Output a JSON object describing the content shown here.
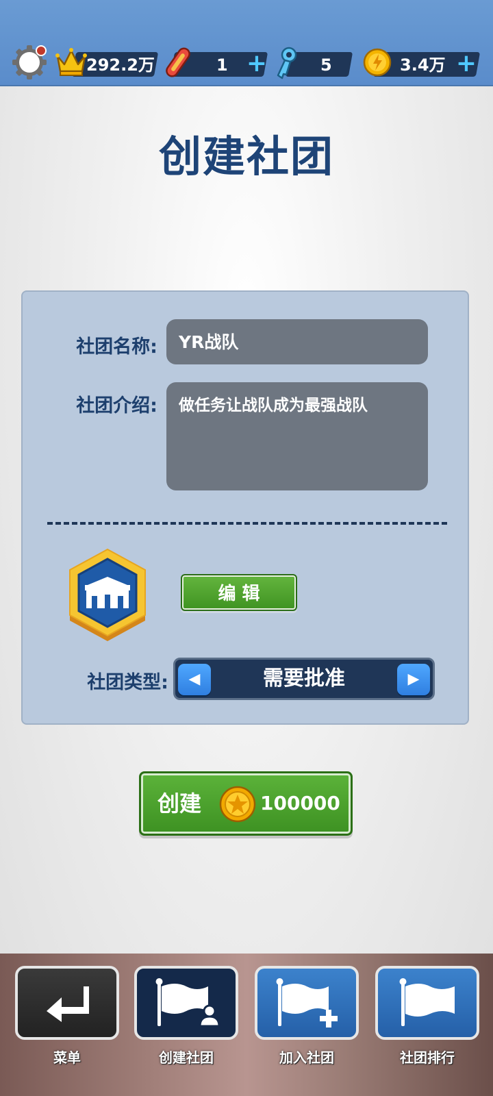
{
  "top_bar": {
    "crown_value": "292.2万",
    "ticket_value": "1",
    "key_value": "5",
    "coin_value": "3.4万",
    "plus": "+"
  },
  "page_title": "创建社团",
  "form": {
    "name_label": "社团名称:",
    "name_value": "YR战队",
    "intro_label": "社团介绍:",
    "intro_value": "做任务让战队成为最强战队",
    "edit_button": "编 辑",
    "type_label": "社团类型:",
    "type_value": "需要批准",
    "prev_arrow": "◀",
    "next_arrow": "▶"
  },
  "create_button": {
    "label": "创建",
    "cost": "100000"
  },
  "bottom_nav": [
    {
      "label": "菜单",
      "icon": "return-arrow-icon"
    },
    {
      "label": "创建社团",
      "icon": "flag-person-icon"
    },
    {
      "label": "加入社团",
      "icon": "flag-plus-icon"
    },
    {
      "label": "社团排行",
      "icon": "flag-icon"
    }
  ],
  "colors": {
    "top_bar": "#5a8ccb",
    "title": "#1e4477",
    "panel": "#b9c9dd",
    "green_button": "#4aa32b",
    "dark_navy": "#1f3657",
    "nav_active": "#14294a",
    "nav_blue": "#2d6fb8",
    "nav_dark": "#2c2c2c"
  }
}
